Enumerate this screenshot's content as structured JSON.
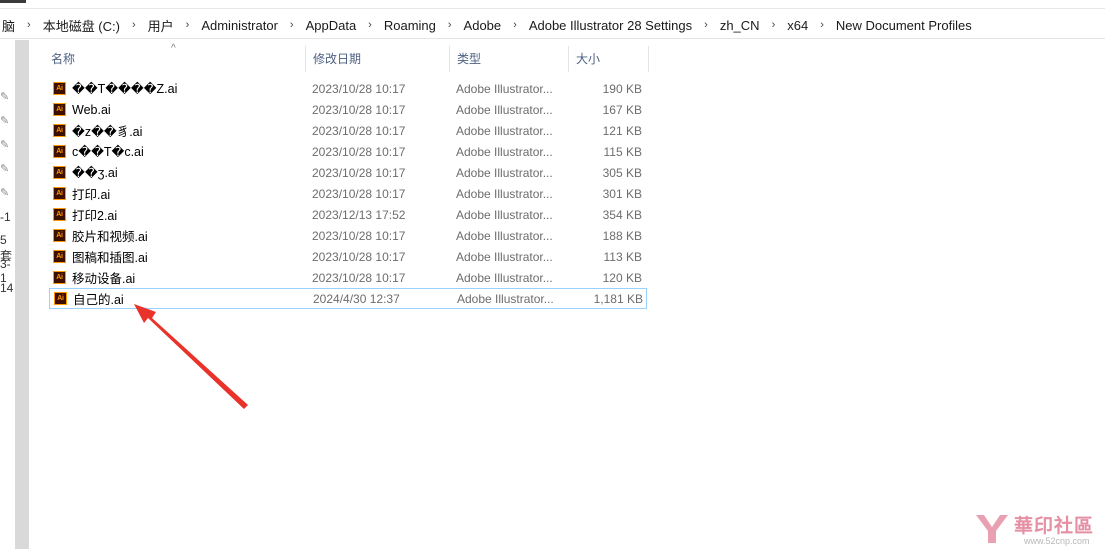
{
  "breadcrumb": {
    "items": [
      "脑",
      "本地磁盘 (C:)",
      "用户",
      "Administrator",
      "AppData",
      "Roaming",
      "Adobe",
      "Adobe Illustrator 28 Settings",
      "zh_CN",
      "x64",
      "New Document Profiles"
    ],
    "separator": "›"
  },
  "nav": {
    "fragments": [
      "-1",
      "5 套",
      "3-1",
      "14"
    ]
  },
  "columns": {
    "name": "名称",
    "date": "修改日期",
    "type": "类型",
    "size": "大小",
    "sort_indicator": "^"
  },
  "files": [
    {
      "name": "��T����Z.ai",
      "date": "2023/10/28 10:17",
      "type": "Adobe Illustrator...",
      "size": "190 KB"
    },
    {
      "name": "Web.ai",
      "date": "2023/10/28 10:17",
      "type": "Adobe Illustrator...",
      "size": "167 KB"
    },
    {
      "name": "�z��豸.ai",
      "date": "2023/10/28 10:17",
      "type": "Adobe Illustrator...",
      "size": "121 KB"
    },
    {
      "name": "c��T�c.ai",
      "date": "2023/10/28 10:17",
      "type": "Adobe Illustrator...",
      "size": "115 KB"
    },
    {
      "name": "��ӡ.ai",
      "date": "2023/10/28 10:17",
      "type": "Adobe Illustrator...",
      "size": "305 KB"
    },
    {
      "name": "打印.ai",
      "date": "2023/10/28 10:17",
      "type": "Adobe Illustrator...",
      "size": "301 KB"
    },
    {
      "name": "打印2.ai",
      "date": "2023/12/13 17:52",
      "type": "Adobe Illustrator...",
      "size": "354 KB"
    },
    {
      "name": "胶片和视频.ai",
      "date": "2023/10/28 10:17",
      "type": "Adobe Illustrator...",
      "size": "188 KB"
    },
    {
      "name": "图稿和插图.ai",
      "date": "2023/10/28 10:17",
      "type": "Adobe Illustrator...",
      "size": "113 KB"
    },
    {
      "name": "移动设备.ai",
      "date": "2023/10/28 10:17",
      "type": "Adobe Illustrator...",
      "size": "120 KB"
    },
    {
      "name": "自己的.ai",
      "date": "2024/4/30 12:37",
      "type": "Adobe Illustrator...",
      "size": "1,181 KB"
    }
  ],
  "file_icon_label": "Ai",
  "colors": {
    "accent_selection": "#99d1ff",
    "header_text": "#4d6082",
    "arrow": "#e8322a",
    "ai_icon_bg": "#3d0f00",
    "ai_icon_fg": "#ff9a00"
  },
  "watermark": {
    "text": "華印社區",
    "url": "www.52cnp.com"
  }
}
